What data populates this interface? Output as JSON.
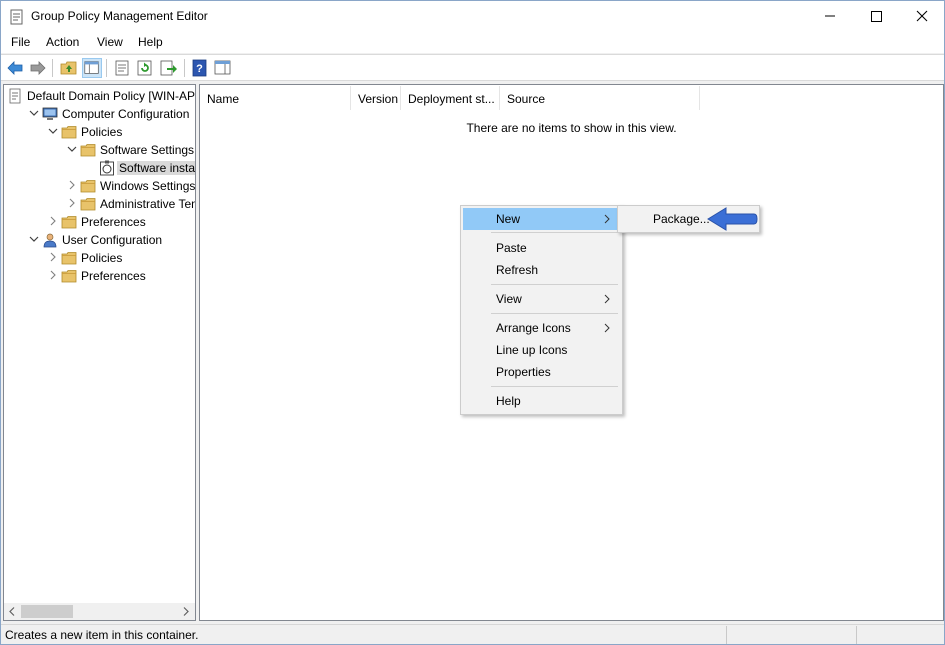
{
  "window": {
    "title": "Group Policy Management Editor",
    "app_icon": "gpo-editor-icon"
  },
  "menubar": {
    "items": [
      "File",
      "Action",
      "View",
      "Help"
    ]
  },
  "toolbar": {
    "buttons": [
      "back-icon",
      "forward-icon",
      "up-folder-icon",
      "show-hide-tree-icon",
      "properties-icon",
      "refresh-icon",
      "export-list-icon",
      "help-icon",
      "show-action-pane-icon"
    ]
  },
  "tree": {
    "items": [
      {
        "label": "Default Domain Policy [WIN-AP",
        "icon": "policy-doc-icon",
        "indent": 0,
        "chevron": "none"
      },
      {
        "label": "Computer Configuration",
        "icon": "computer-icon",
        "indent": 1,
        "chevron": "down"
      },
      {
        "label": "Policies",
        "icon": "folder-icon",
        "indent": 2,
        "chevron": "down"
      },
      {
        "label": "Software Settings",
        "icon": "folder-icon",
        "indent": 3,
        "chevron": "down"
      },
      {
        "label": "Software installat",
        "icon": "software-install-icon",
        "indent": 4,
        "chevron": "none",
        "selected": true
      },
      {
        "label": "Windows Settings",
        "icon": "folder-icon",
        "indent": 3,
        "chevron": "right"
      },
      {
        "label": "Administrative Temp",
        "icon": "folder-icon",
        "indent": 3,
        "chevron": "right"
      },
      {
        "label": "Preferences",
        "icon": "folder-icon",
        "indent": 2,
        "chevron": "right"
      },
      {
        "label": "User Configuration",
        "icon": "user-icon",
        "indent": 1,
        "chevron": "down"
      },
      {
        "label": "Policies",
        "icon": "folder-icon",
        "indent": 2,
        "chevron": "right"
      },
      {
        "label": "Preferences",
        "icon": "folder-icon",
        "indent": 2,
        "chevron": "right"
      }
    ]
  },
  "list": {
    "columns": [
      "Name",
      "Version",
      "Deployment st...",
      "Source"
    ],
    "empty_message": "There are no items to show in this view."
  },
  "context_menu": {
    "items": [
      {
        "label": "New",
        "submenu": true,
        "highlighted": true
      },
      {
        "label": "Paste"
      },
      {
        "label": "Refresh"
      },
      {
        "label": "View",
        "submenu": true
      },
      {
        "label": "Arrange Icons",
        "submenu": true
      },
      {
        "label": "Line up Icons"
      },
      {
        "label": "Properties"
      },
      {
        "label": "Help"
      }
    ],
    "submenu_new": {
      "items": [
        "Package..."
      ]
    }
  },
  "status": {
    "text": "Creates a new item in this container."
  },
  "colors": {
    "highlight": "#91c9f7",
    "pointer_arrow": "#3b6fd6",
    "folder": "#e8c36a"
  }
}
